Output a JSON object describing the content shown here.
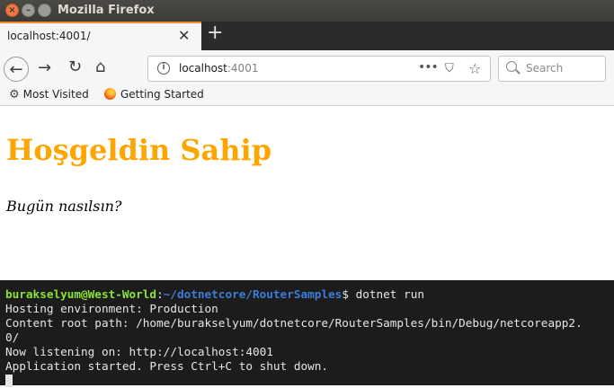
{
  "window": {
    "title": "Mozilla Firefox"
  },
  "tab": {
    "title": "localhost:4001/"
  },
  "urlbar": {
    "host": "localhost",
    "port": ":4001"
  },
  "search": {
    "placeholder": "Search"
  },
  "bookmarks": [
    {
      "label": "Most Visited"
    },
    {
      "label": "Getting Started"
    }
  ],
  "page": {
    "heading": "Hoşgeldin Sahip",
    "subtext": "Bugün nasılsın?"
  },
  "terminal": {
    "prompt_user": "burakselyum@West-World",
    "prompt_sep": ":",
    "prompt_path": "~/dotnetcore/RouterSamples",
    "prompt_cmd": "$ dotnet run",
    "lines": [
      "Hosting environment: Production",
      "Content root path: /home/burakselyum/dotnetcore/RouterSamples/bin/Debug/netcoreapp2.",
      "0/",
      "Now listening on: http://localhost:4001",
      "Application started. Press Ctrl+C to shut down."
    ]
  },
  "colors": {
    "heading": "#ffa500",
    "tab_accent": "#f38c2b",
    "terminal_user": "#8ae234",
    "terminal_path": "#3b7dd8"
  },
  "icons": [
    "close-icon",
    "minimize-icon",
    "maximize-icon",
    "back-icon",
    "forward-icon",
    "reload-icon",
    "home-icon",
    "info-icon",
    "more-icon",
    "pocket-icon",
    "star-icon",
    "search-icon",
    "gear-icon",
    "firefox-icon",
    "new-tab-icon"
  ]
}
